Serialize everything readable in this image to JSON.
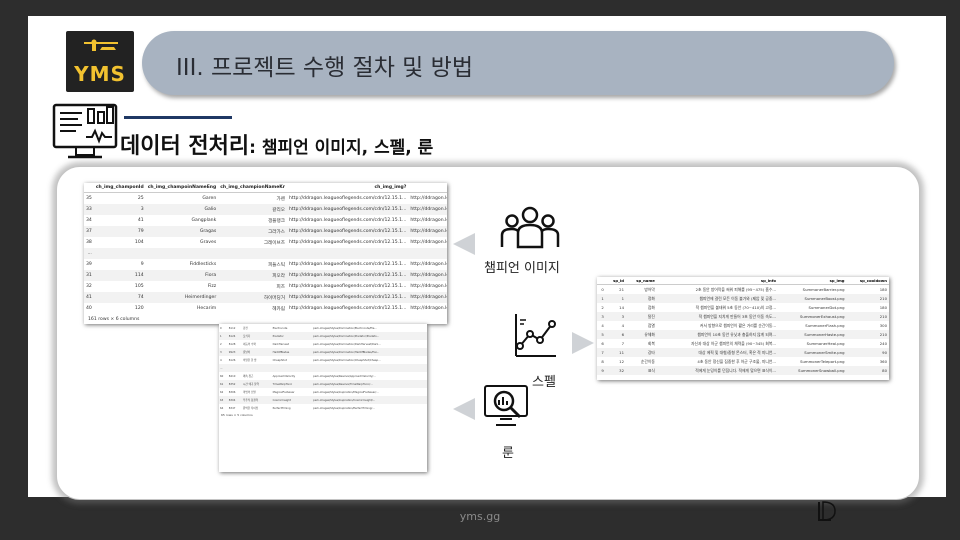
{
  "logo": {
    "text": "YMS"
  },
  "title": "III. 프로젝트 수행 절차 및 방법",
  "subtitle": {
    "main": "데이터 전처리",
    "detail": ": 챔피언 이미지,  스펠, 룬"
  },
  "labels": {
    "champion_image": "챔피언 이미지",
    "spell": "스펠",
    "rune": "룬"
  },
  "champion_table": {
    "headers": [
      "ch_img_champonId",
      "ch_img_champoinNameEng",
      "ch_img_championNameKr",
      "ch_img_img?",
      "ch_"
    ],
    "rows": [
      [
        "35",
        "25",
        "Garen",
        "가렌",
        "http://ddragon.leagueoflegends.com/cdn/12.15.1...",
        "http://ddragon.leagueoflegends.com/cdn/"
      ],
      [
        "33",
        "3",
        "Galio",
        "갈리오",
        "http://ddragon.leagueoflegends.com/cdn/12.15.1...",
        "http://ddragon.leagueoflegends.com/cdn/"
      ],
      [
        "34",
        "41",
        "Gangplank",
        "갱플랭크",
        "http://ddragon.leagueoflegends.com/cdn/12.15.1...",
        "http://ddragon.leagueoflegends.com/cdn/"
      ],
      [
        "37",
        "79",
        "Gragas",
        "그라가스",
        "http://ddragon.leagueoflegends.com/cdn/12.15.1...",
        "http://ddragon.leagueoflegends.com/cdn/"
      ],
      [
        "38",
        "104",
        "Graves",
        "그레이브즈",
        "http://ddragon.leagueoflegends.com/cdn/12.15.1...",
        "http://ddragon.leagueoflegends.com/cdn/"
      ],
      [
        "...",
        "",
        "",
        "",
        "",
        ""
      ],
      [
        "39",
        "9",
        "Fiddlesticks",
        "피들스틱",
        "http://ddragon.leagueoflegends.com/cdn/12.15.1...",
        "http://ddragon.leagueoflegends.com/cdn/"
      ],
      [
        "31",
        "114",
        "Fiora",
        "피오라",
        "http://ddragon.leagueoflegends.com/cdn/12.15.1...",
        "http://ddragon.leagueoflegends.com/cdn/"
      ],
      [
        "32",
        "105",
        "Fizz",
        "피즈",
        "http://ddragon.leagueoflegends.com/cdn/12.15.1...",
        "http://ddragon.leagueoflegends.com/cdn/"
      ],
      [
        "41",
        "74",
        "Heimerdinger",
        "하이머딩거",
        "http://ddragon.leagueoflegends.com/cdn/12.15.1...",
        "http://ddragon.leagueoflegends.com/cdn/"
      ],
      [
        "40",
        "120",
        "Hecarim",
        "헤카림",
        "http://ddragon.leagueoflegends.com/cdn/12.15.1...",
        "http://ddragon.leagueoflegends.com/cdn/"
      ]
    ],
    "footer": "161 rows × 6 columns"
  },
  "spell_table": {
    "headers": [
      "sp_id",
      "sp_name",
      "sp_info",
      "sp_img",
      "sp_cooldown"
    ],
    "rows": [
      [
        "0",
        "21",
        "방어막",
        "2초 동안 방어막을 씌워 피해를 (95~475) 흡수...",
        "SummonerBarrier.png",
        "180"
      ],
      [
        "1",
        "1",
        "정화",
        "챔피언에 걸린 모든 이동 불가와 (제압 및 공중...",
        "SummonerBoost.png",
        "210"
      ],
      [
        "2",
        "14",
        "점화",
        "적 챔피언을 불태워 5초 동안 (70~410)의 고정...",
        "SummonerDot.png",
        "180"
      ],
      [
        "3",
        "3",
        "탈진",
        "적 챔피언을 지치게 만들어 3초 동안 이동 속도...",
        "SummonerExhaust.png",
        "210"
      ],
      [
        "4",
        "4",
        "점멸",
        "커서 방향으로 챔피언이 짧은 거리를 순간이동...",
        "SummonerFlash.png",
        "300"
      ],
      [
        "5",
        "6",
        "유체화",
        "챔피언이 10초 동안 유닛과 충돌하지 않게 되며...",
        "SummonerHaste.png",
        "210"
      ],
      [
        "6",
        "7",
        "회복",
        "자신과 대상 아군 챔피언의 체력을 (90~345) 회복...",
        "SummonerHeal.png",
        "240"
      ],
      [
        "7",
        "11",
        "강타",
        "대상 에픽 및 대형/중형 몬스터, 혹은 적 미니언...",
        "SummonerSmite.png",
        "90"
      ],
      [
        "8",
        "12",
        "순간이동",
        "4초 동안 정신을 집중한 후 아군 구조물, 미니언...",
        "SummonerTeleport.png",
        "360"
      ],
      [
        "9",
        "32",
        "표식",
        "적에게 눈덩이를 던집니다. 적에게 맞으면 표식이...",
        "SummonerSnowball.png",
        "80"
      ]
    ]
  },
  "rune_table": {
    "rows": [
      [
        "0",
        "8112",
        "감전",
        "Electrocute",
        "perk-images/Styles/Domination/Electrocute/Ele..."
      ],
      [
        "1",
        "8124",
        "포식자",
        "Predator",
        "perk-images/Styles/Domination/Predator/Predato..."
      ],
      [
        "2",
        "8128",
        "어둠의 수확",
        "DarkHarvest",
        "perk-images/Styles/Domination/DarkHarvest/Dark..."
      ],
      [
        "3",
        "9923",
        "칼날비",
        "HailOfBlades",
        "perk-images/Styles/Domination/HailOfBlades/Hai..."
      ],
      [
        "4",
        "8126",
        "비열한 한 방",
        "CheapShot",
        "perk-images/Styles/Domination/CheapShot/Cheap..."
      ],
      [
        "...",
        "",
        "",
        "",
        ""
      ],
      [
        "60",
        "8410",
        "쾌속 접근",
        "ApproachVelocity",
        "perk-images/Styles/Resolve/ApproachVelocity/..."
      ],
      [
        "61",
        "8352",
        "시간 왜곡 물약",
        "TimeWarpTonic",
        "perk-images/Styles/Resolve/TimeWarpTonic/..."
      ],
      [
        "62",
        "8306",
        "마법의 신발",
        "MagicalFootwear",
        "perk-images/Styles/Inspiration/MagicalFootwear/..."
      ],
      [
        "63",
        "8304",
        "우주적 통찰력",
        "CosmicInsight",
        "perk-images/Styles/Inspiration/CosmicInsight/..."
      ],
      [
        "64",
        "8347",
        "완벽한 타이밍",
        "PerfectTiming",
        "perk-images/Styles/Inspiration/PerfectTiming/..."
      ]
    ],
    "footer": "65 rows × 5 columns"
  },
  "footer": {
    "site": "yms.gg"
  }
}
